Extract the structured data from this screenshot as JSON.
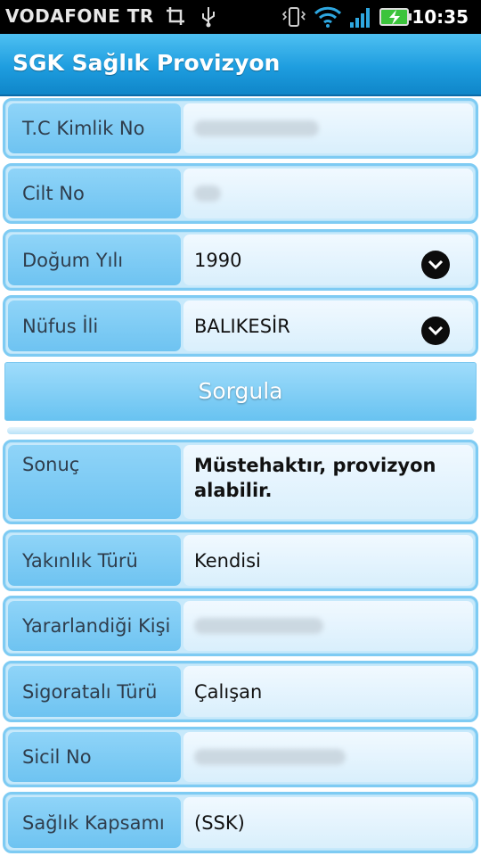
{
  "status_bar": {
    "carrier": "VODAFONE TR",
    "time": "10:35"
  },
  "title_bar": {
    "title": "SGK Sağlık Provizyon"
  },
  "form": {
    "tc_kimlik": {
      "label": "T.C Kimlik No"
    },
    "cilt_no": {
      "label": "Cilt No"
    },
    "dogum_yili": {
      "label": "Doğum Yılı",
      "value": "1990"
    },
    "nufus_ili": {
      "label": "Nüfus İli",
      "value": "BALIKESİR"
    },
    "submit_label": "Sorgula"
  },
  "results": {
    "sonuc": {
      "label": "Sonuç",
      "value": "Müstehaktır, provizyon alabilir."
    },
    "yakinlik": {
      "label": "Yakınlık Türü",
      "value": "Kendisi"
    },
    "yararlanan": {
      "label": "Yararlandiği Kişi"
    },
    "sigortali": {
      "label": "Sigoratalı Türü",
      "value": "Çalışan"
    },
    "sicil": {
      "label": "Sicil No"
    },
    "kapsam": {
      "label": "Sağlık Kapsamı",
      "value": "(SSK)"
    }
  },
  "colors": {
    "accent": "#1e9ddf",
    "row_border": "#7ecbf3",
    "label_bg": "#7ac9f4",
    "value_bg": "#e3f3fd"
  },
  "icons": [
    "screenshot-icon",
    "usb-icon",
    "vibrate-icon",
    "wifi-icon",
    "signal-icon",
    "battery-charging-icon",
    "chevron-down-icon"
  ]
}
